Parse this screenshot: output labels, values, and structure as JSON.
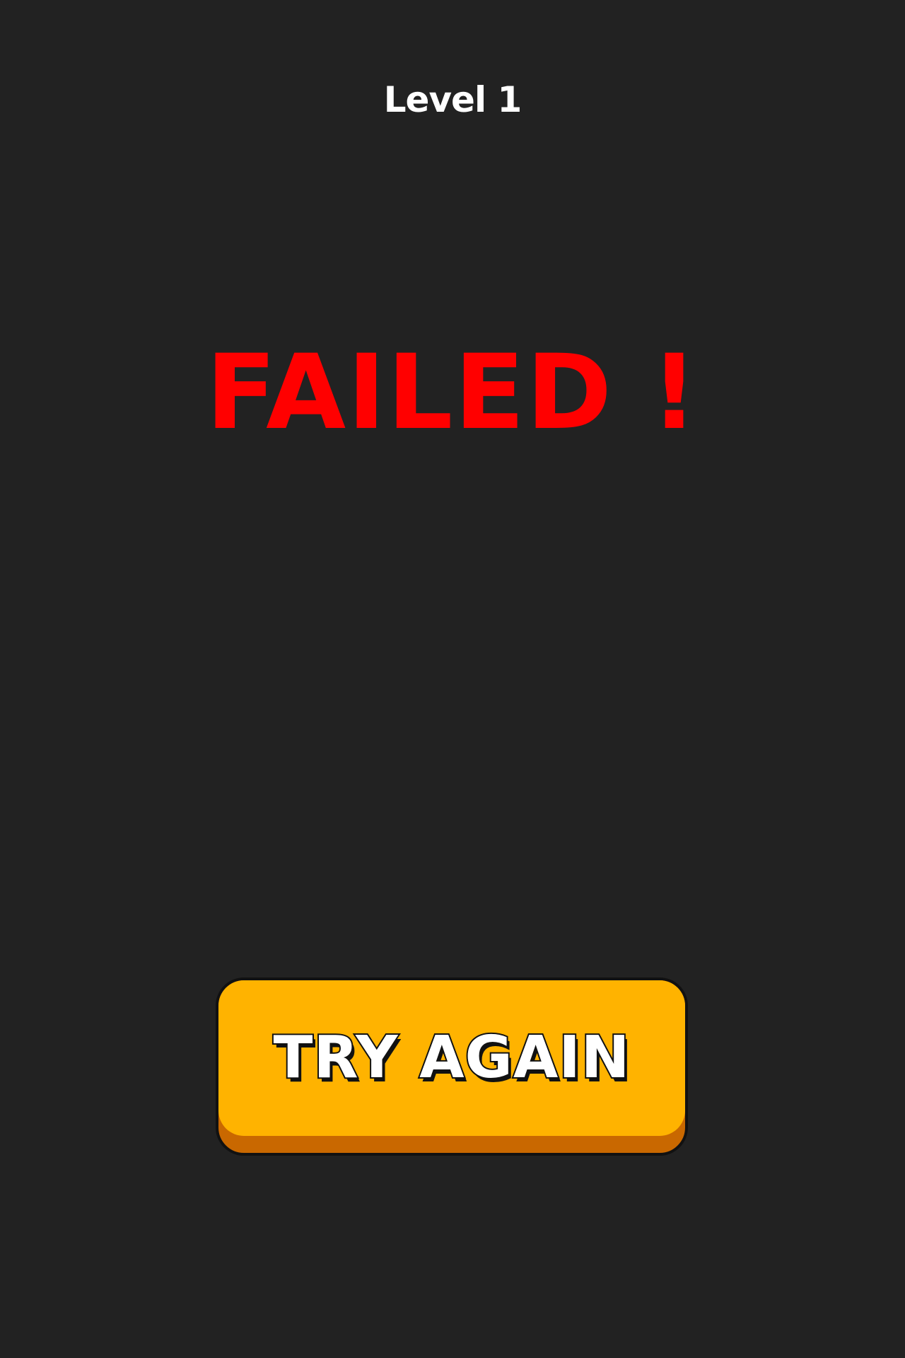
{
  "header": {
    "level_label": "Level 1"
  },
  "result": {
    "title": "FAILED !",
    "title_color": "#ff0000"
  },
  "actions": {
    "try_again_label": "TRY AGAIN",
    "button_color": "#ffb300",
    "button_shadow_color": "#c96800"
  },
  "theme": {
    "background": "#222222",
    "text": "#ffffff"
  }
}
